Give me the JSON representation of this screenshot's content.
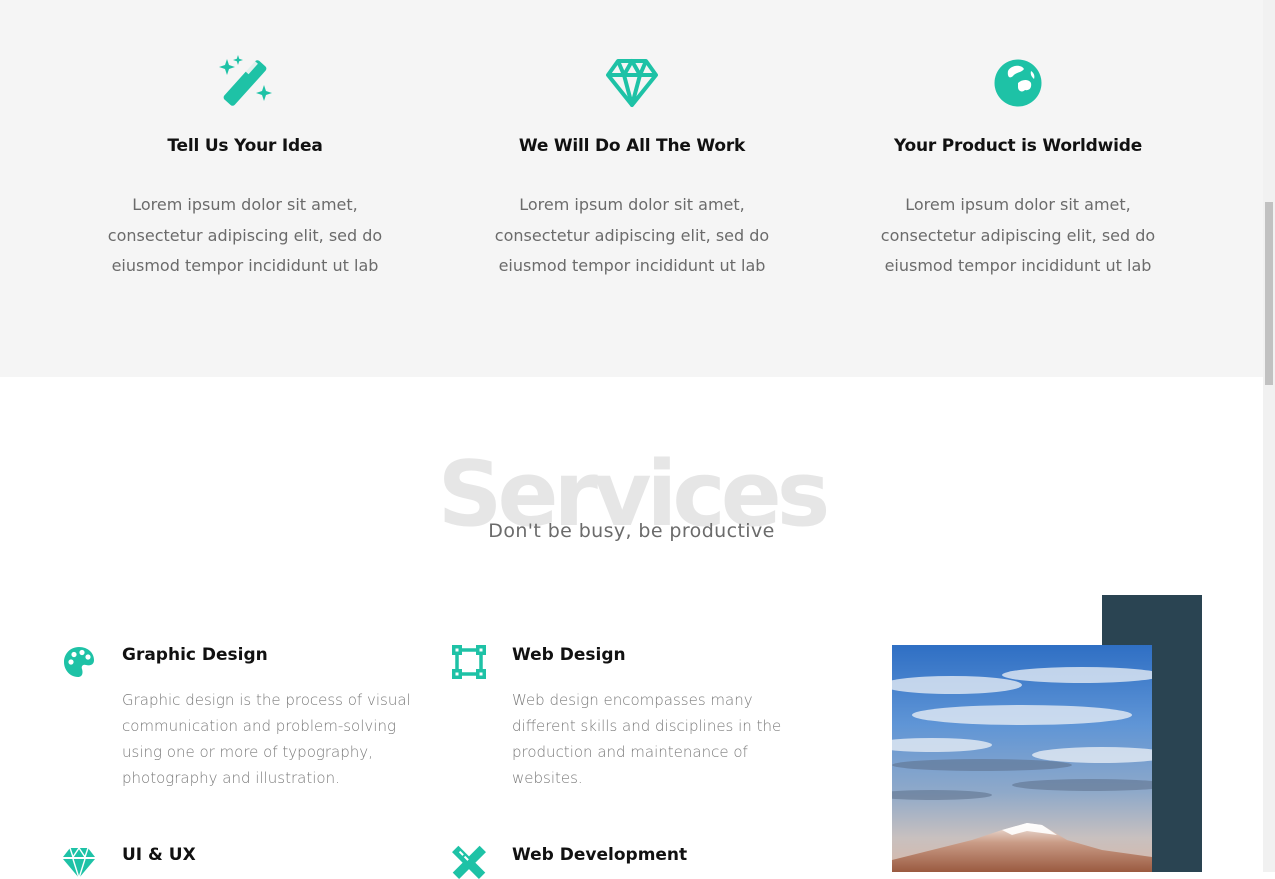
{
  "colors": {
    "accent": "#1ec2a6",
    "dark_panel": "#2a4452",
    "features_bg": "#f5f5f5"
  },
  "features": [
    {
      "icon": "magic-wand-icon",
      "title": "Tell Us Your Idea",
      "text": "Lorem ipsum dolor sit amet, consectetur adipiscing elit, sed do eiusmod tempor incididunt ut lab"
    },
    {
      "icon": "diamond-icon",
      "title": "We Will Do All The Work",
      "text": "Lorem ipsum dolor sit amet, consectetur adipiscing elit, sed do eiusmod tempor incididunt ut lab"
    },
    {
      "icon": "globe-icon",
      "title": "Your Product is Worldwide",
      "text": "Lorem ipsum dolor sit amet, consectetur adipiscing elit, sed do eiusmod tempor incididunt ut lab"
    }
  ],
  "services": {
    "title": "Services",
    "subtitle": "Don't be busy, be productive",
    "items": [
      {
        "icon": "palette-icon",
        "title": "Graphic Design",
        "text": "Graphic design is the process of visual communication and problem-solving using one or more of typography, photography and illustration."
      },
      {
        "icon": "vector-square-icon",
        "title": "Web Design",
        "text": "Web design encompasses many different skills and disciplines in the production and maintenance of websites."
      },
      {
        "icon": "diamond-icon",
        "title": "UI & UX",
        "text": ""
      },
      {
        "icon": "pencil-ruler-icon",
        "title": "Web Development",
        "text": ""
      }
    ]
  }
}
